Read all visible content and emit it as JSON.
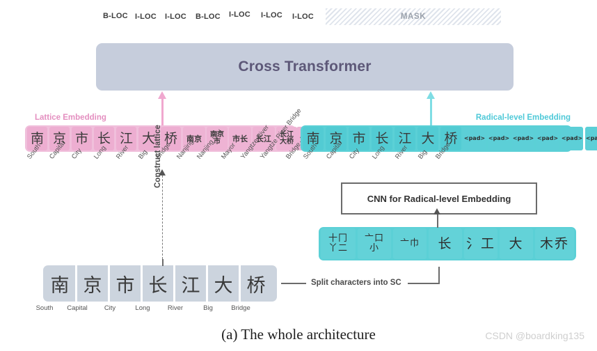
{
  "figure": {
    "caption": "(a) The whole architecture",
    "watermark": "CSDN @boardking135"
  },
  "output_tags": {
    "labels": [
      "B-LOC",
      "I-LOC",
      "I-LOC",
      "B-LOC",
      "I-LOC",
      "I-LOC",
      "I-LOC"
    ],
    "mask_label": "MASK"
  },
  "cross_transformer": {
    "label": "Cross Transformer",
    "box_color": "#c6cddc",
    "text_color": "#5d5878"
  },
  "lattice": {
    "caption": "Lattice Embedding",
    "caption_color": "#e48fc0",
    "row_color": "#f0bfdb",
    "chars": [
      "南",
      "京",
      "市",
      "长",
      "江",
      "大",
      "桥"
    ],
    "char_glosses": [
      "South",
      "Capital",
      "City",
      "Long",
      "River",
      "Big",
      "Bridge"
    ],
    "words": [
      {
        "text": "南京",
        "lines": [
          "南京"
        ]
      },
      {
        "text": "南京市",
        "lines": [
          "南京",
          "市"
        ]
      },
      {
        "text": "市长",
        "lines": [
          "市长"
        ]
      },
      {
        "text": "长江",
        "lines": [
          "长江"
        ]
      },
      {
        "text": "长江大桥",
        "lines": [
          "长江",
          "大桥"
        ]
      },
      {
        "text": "大桥",
        "lines": [
          "大桥"
        ]
      }
    ],
    "word_glosses": [
      "Nanjing",
      "Nanjing City",
      "Mayor",
      "Yangtze River",
      "Yangtze River Bridge",
      "Bridge"
    ]
  },
  "radical": {
    "caption": "Radical-level Embedding",
    "caption_color": "#4ec9d8",
    "row_color": "#5bd0d6",
    "chars": [
      "南",
      "京",
      "市",
      "长",
      "江",
      "大",
      "桥"
    ],
    "char_glosses": [
      "South",
      "Capital",
      "City",
      "Long",
      "River",
      "Big",
      "Bridge"
    ],
    "pads": [
      "<pad>",
      "<pad>",
      "<pad>",
      "<pad>",
      "<pad>",
      "<pad>"
    ]
  },
  "cnn_box": {
    "label": "CNN for Radical-level Embedding"
  },
  "radical_split": {
    "cells": [
      {
        "lines": [
          "十冂",
          "丫二"
        ]
      },
      {
        "lines": [
          "亠口",
          "小"
        ]
      },
      {
        "lines": [
          "亠巾"
        ]
      },
      {
        "lines": [
          "长"
        ]
      },
      {
        "lines": [
          "氵工"
        ]
      },
      {
        "lines": [
          "大"
        ]
      },
      {
        "lines": [
          "木乔"
        ]
      }
    ]
  },
  "sentence": {
    "chars": [
      "南",
      "京",
      "市",
      "长",
      "江",
      "大",
      "桥"
    ],
    "glosses": [
      "South",
      "Capital",
      "City",
      "Long",
      "River",
      "Big",
      "Bridge"
    ]
  },
  "connectors": {
    "construct_lattice": "Construct lattice",
    "split_characters": "Split characters into SC"
  },
  "colors": {
    "pink": "#eeb3d4",
    "cyan": "#5ccfd7",
    "slate": "#ccd4de",
    "transformer": "#c6cddc"
  }
}
